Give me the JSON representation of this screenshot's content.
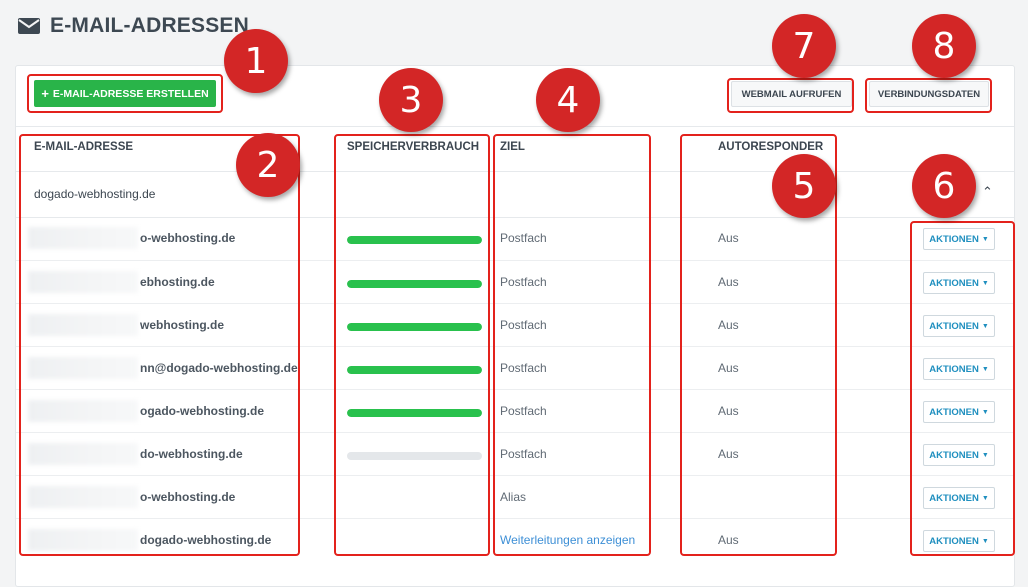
{
  "page": {
    "title": "E-MAIL-ADRESSEN",
    "title_icon": "envelope-icon"
  },
  "toolbar": {
    "create_label": "E-MAIL-ADRESSE ERSTELLEN",
    "create_icon": "plus-icon",
    "webmail_label": "WEBMAIL AUFRUFEN",
    "verbindung_label": "VERBINDUNGSDATEN"
  },
  "table": {
    "headers": {
      "email": "E-MAIL-ADRESSE",
      "speicher": "SPEICHERVERBRAUCH",
      "ziel": "ZIEL",
      "autoresponder": "AUTORESPONDER"
    },
    "domain": "dogado-webhosting.de",
    "rows": [
      {
        "email": "o-webhosting.de",
        "usage": 1.0,
        "ziel": "Postfach",
        "autoresponder": "Aus",
        "action": "AKTIONEN"
      },
      {
        "email": "ebhosting.de",
        "usage": 1.0,
        "ziel": "Postfach",
        "autoresponder": "Aus",
        "action": "AKTIONEN"
      },
      {
        "email": "webhosting.de",
        "usage": 1.0,
        "ziel": "Postfach",
        "autoresponder": "Aus",
        "action": "AKTIONEN"
      },
      {
        "email": "nn@dogado-webhosting.de",
        "usage": 1.0,
        "ziel": "Postfach",
        "autoresponder": "Aus",
        "action": "AKTIONEN"
      },
      {
        "email": "ogado-webhosting.de",
        "usage": 1.0,
        "ziel": "Postfach",
        "autoresponder": "Aus",
        "action": "AKTIONEN"
      },
      {
        "email": "do-webhosting.de",
        "usage": 0.0,
        "ziel": "Postfach",
        "autoresponder": "Aus",
        "action": "AKTIONEN"
      },
      {
        "email": "o-webhosting.de",
        "usage": null,
        "ziel": "Alias",
        "autoresponder": "",
        "action": "AKTIONEN"
      },
      {
        "email": "dogado-webhosting.de",
        "usage": null,
        "ziel": "Weiterleitungen anzeigen",
        "autoresponder": "Aus",
        "action": "AKTIONEN"
      }
    ]
  },
  "annotations": [
    "1",
    "2",
    "3",
    "4",
    "5",
    "6",
    "7",
    "8"
  ],
  "colors": {
    "accent_green": "#29b449",
    "bar_green": "#29c14d",
    "link_blue": "#3d8fd6",
    "action_blue": "#1f8fbf",
    "annotation_red": "#d32626"
  }
}
